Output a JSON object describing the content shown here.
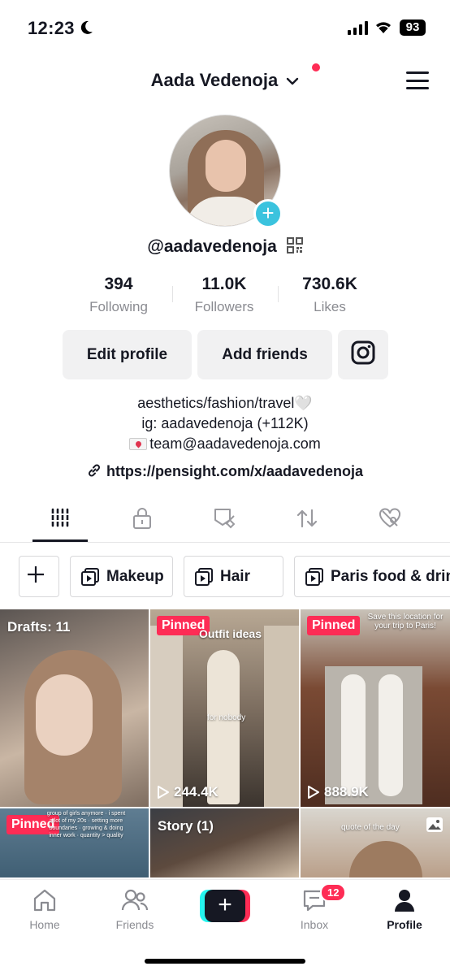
{
  "status_bar": {
    "time": "12:23",
    "battery": "93"
  },
  "header": {
    "title": "Aada Vedenoja"
  },
  "profile": {
    "handle": "@aadavedenoja",
    "stats": [
      {
        "value": "394",
        "label": "Following"
      },
      {
        "value": "11.0K",
        "label": "Followers"
      },
      {
        "value": "730.6K",
        "label": "Likes"
      }
    ],
    "buttons": {
      "edit": "Edit profile",
      "add_friends": "Add friends"
    },
    "bio": {
      "line1": "aesthetics/fashion/travel🤍",
      "line2": "ig: aadavedenoja (+112K)",
      "line3": "team@aadavedenoja.com"
    },
    "link": "https://pensight.com/x/aadavedenoja"
  },
  "tabs": [
    "videos-grid-icon",
    "private-lock-icon",
    "favorites-icon",
    "reposts-icon",
    "liked-icon"
  ],
  "collections": [
    "Makeup",
    "Hair",
    "Paris food & drin"
  ],
  "grid": {
    "cell1": {
      "label": "Drafts: 11"
    },
    "cell2": {
      "badge": "Pinned",
      "overlay": "Outfit ideas",
      "overlay2": "for nobody",
      "views": "244.4K"
    },
    "cell3": {
      "badge": "Pinned",
      "overlay": "Save this location for your trip to Paris!",
      "views": "888.9K"
    },
    "cell4": {
      "badge": "Pinned",
      "overlay": "group of girls anymore · i spent a lot of my 20s · setting more boundaries · growing & doing inner work · quantity > quality"
    },
    "cell5": {
      "label": "Story (1)"
    },
    "cell6": {
      "overlay": "quote of the day"
    }
  },
  "nav": {
    "home": "Home",
    "friends": "Friends",
    "inbox": "Inbox",
    "inbox_badge": "12",
    "profile": "Profile"
  },
  "colors": {
    "accent": "#fe2c55",
    "cyan": "#25f4ee",
    "text": "#161823",
    "muted": "#8a8b91"
  }
}
